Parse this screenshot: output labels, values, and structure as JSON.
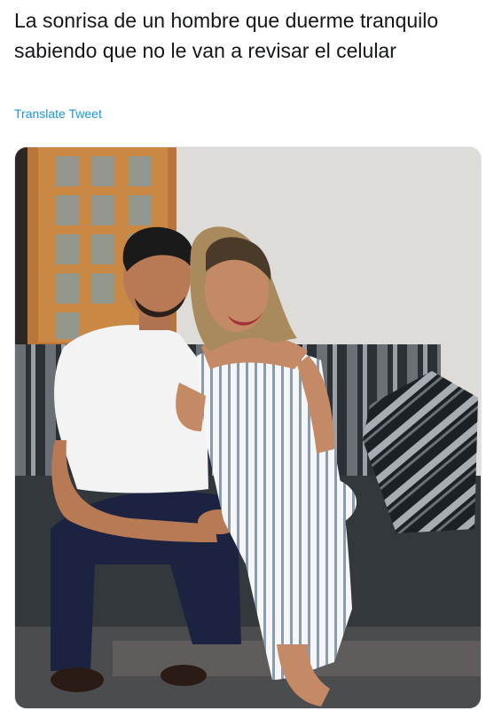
{
  "tweet": {
    "text": "La sonrisa de un hombre que duerme tranquilo sabiendo que no le van a revisar el celular",
    "translate_label": "Translate Tweet"
  },
  "media": {
    "description_icon": "photo-image",
    "colors": {
      "wall": "#dedcd8",
      "door_wood": "#b8763a",
      "sofa": "#2e3338",
      "shirt": "#f3f3f3",
      "pants": "#1c2340",
      "dress_stripe": "#7f93a8",
      "hair": "#1a1a1a",
      "skin": "#b77a55"
    }
  }
}
